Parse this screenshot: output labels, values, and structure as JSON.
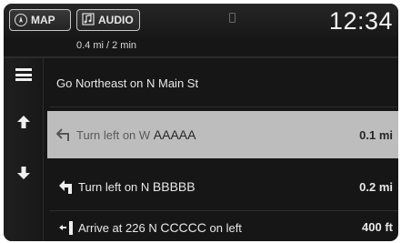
{
  "header": {
    "tabs": [
      {
        "label": "MAP",
        "icon": "compass-icon"
      },
      {
        "label": "AUDIO",
        "icon": "music-note-icon"
      }
    ],
    "clock": "12:34"
  },
  "trip_summary": "0.4 mi / 2 min",
  "sidebar": {
    "buttons": [
      {
        "name": "menu",
        "icon": "menu-icon"
      },
      {
        "name": "scroll-up",
        "icon": "arrow-up-icon"
      },
      {
        "name": "scroll-down",
        "icon": "arrow-down-icon"
      }
    ]
  },
  "directions": [
    {
      "text": "Go Northeast on N Main St",
      "distance": "",
      "icon": "",
      "selected": false
    },
    {
      "text_prefix": "Turn left on W ",
      "text_name": "AAAAA",
      "distance": "0.1 mi",
      "icon": "turn-left-icon",
      "selected": true
    },
    {
      "text_prefix": "Turn left on N ",
      "text_name": "BBBBB",
      "distance": "0.2 mi",
      "icon": "turn-left-icon",
      "selected": false
    },
    {
      "text_prefix": "Arrive at 226 N ",
      "text_name": "CCCCC",
      "text_suffix": " on left",
      "distance": "400 ft",
      "icon": "arrive-left-icon",
      "selected": false
    }
  ],
  "colors": {
    "background": "#161616",
    "selected_row": "#bdbdbd",
    "text": "#e8e8e8"
  }
}
